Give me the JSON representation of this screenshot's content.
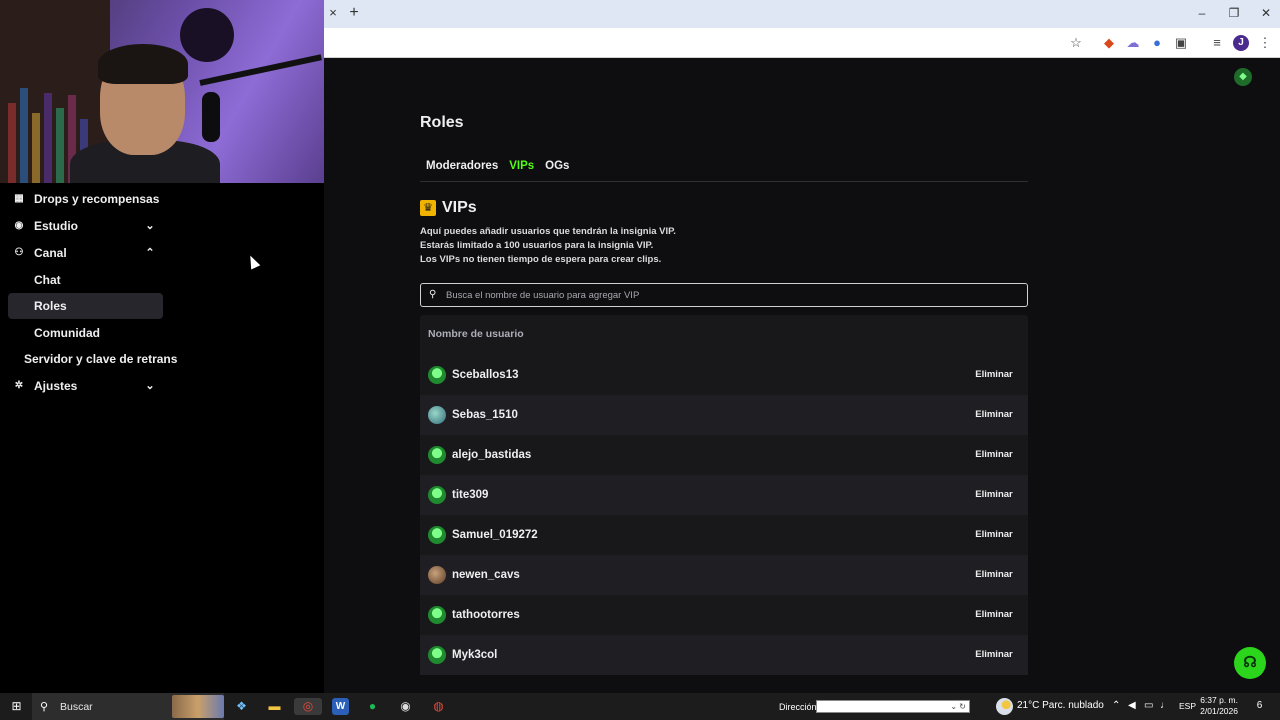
{
  "browser": {
    "tab_close": "×",
    "tab_new": "+",
    "window_controls": {
      "minimize": "–",
      "restore": "❐",
      "close": "✕"
    },
    "profile_initial": "J"
  },
  "sidebar": {
    "items": [
      {
        "label": "Drops y recompensas",
        "icon": "gift-icon"
      },
      {
        "label": "Estudio",
        "icon": "studio-icon",
        "chevron": "down"
      },
      {
        "label": "Canal",
        "icon": "channel-icon",
        "chevron": "up"
      },
      {
        "label": "Chat"
      },
      {
        "label": "Roles",
        "active": true
      },
      {
        "label": "Comunidad"
      },
      {
        "label": "Servidor y clave de retrans"
      },
      {
        "label": "Ajustes",
        "icon": "gear-icon",
        "chevron": "down"
      }
    ]
  },
  "page": {
    "title": "Roles",
    "tabs": [
      {
        "label": "Moderadores",
        "active": false
      },
      {
        "label": "VIPs",
        "active": true
      },
      {
        "label": "OGs",
        "active": false
      }
    ],
    "section_title": "VIPs",
    "description": [
      "Aquí puedes añadir usuarios que tendrán la insignia VIP.",
      "Estarás limitado a 100 usuarios para la insignia VIP.",
      "Los VIPs no tienen tiempo de espera para crear clips."
    ],
    "search_placeholder": "Busca el nombre de usuario para agregar VIP",
    "column_header": "Nombre de usuario",
    "remove_label": "Eliminar",
    "users": [
      "Sceballos13",
      "Sebas_1510",
      "alejo_bastidas",
      "tite309",
      "Samuel_019272",
      "newen_cavs",
      "tathootorres",
      "Myk3col"
    ]
  },
  "taskbar": {
    "search_label": "Buscar",
    "address_label": "Dirección",
    "weather": "21°C  Parc. nublado",
    "language": "ESP",
    "time": "6:37 p. m.",
    "date": "2/01/2026",
    "notifications": "6"
  },
  "colors": {
    "accent": "#53fc18",
    "background": "#0e0e10",
    "panel": "#18181b",
    "crown": "#f0b400"
  }
}
